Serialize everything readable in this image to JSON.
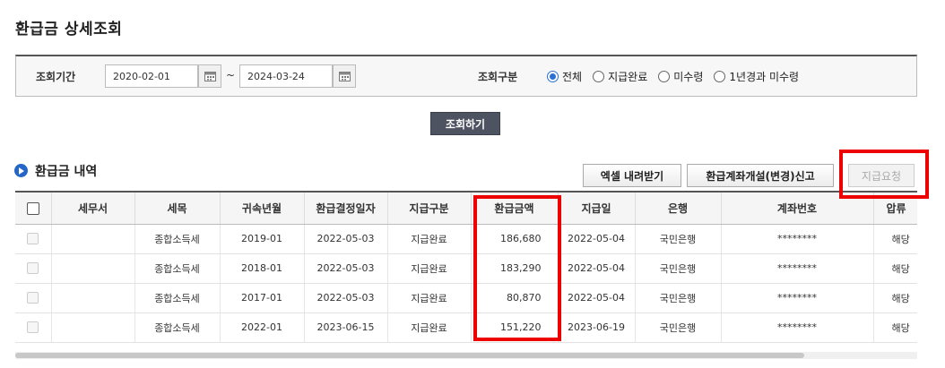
{
  "page": {
    "title": "환급금 상세조회"
  },
  "search": {
    "period_label": "조회기간",
    "start_date": "2020-02-01",
    "tilde": "~",
    "end_date": "2024-03-24",
    "type_label": "조회구분",
    "options": [
      {
        "label": "전체",
        "selected": true
      },
      {
        "label": "지급완료",
        "selected": false
      },
      {
        "label": "미수령",
        "selected": false
      },
      {
        "label": "1년경과 미수령",
        "selected": false
      }
    ],
    "search_button": "조회하기"
  },
  "section": {
    "title": "환급금 내역",
    "excel_button": "엑셀 내려받기",
    "account_button": "환급계좌개설(변경)신고",
    "request_button": "지급요청"
  },
  "table": {
    "columns": [
      "세무서",
      "세목",
      "귀속년월",
      "환급결정일자",
      "지급구분",
      "환급금액",
      "지급일",
      "은행",
      "계좌번호",
      "압류"
    ],
    "rows": [
      {
        "office": "",
        "tax": "종합소득세",
        "period": "2019-01",
        "decision": "2022-05-03",
        "type": "지급완료",
        "amount": "186,680",
        "paid": "2022-05-04",
        "bank": "국민은행",
        "account": "********",
        "seizure": "해당"
      },
      {
        "office": "",
        "tax": "종합소득세",
        "period": "2018-01",
        "decision": "2022-05-03",
        "type": "지급완료",
        "amount": "183,290",
        "paid": "2022-05-04",
        "bank": "국민은행",
        "account": "********",
        "seizure": "해당"
      },
      {
        "office": "",
        "tax": "종합소득세",
        "period": "2017-01",
        "decision": "2022-05-03",
        "type": "지급완료",
        "amount": "80,870",
        "paid": "2022-05-04",
        "bank": "국민은행",
        "account": "********",
        "seizure": "해당"
      },
      {
        "office": "",
        "tax": "종합소득세",
        "period": "2022-01",
        "decision": "2023-06-15",
        "type": "지급완료",
        "amount": "151,220",
        "paid": "2023-06-19",
        "bank": "국민은행",
        "account": "********",
        "seizure": "해당"
      }
    ]
  },
  "colors": {
    "accent": "#2366c7",
    "highlight": "#ee0000",
    "button_dark": "#4d5360"
  }
}
